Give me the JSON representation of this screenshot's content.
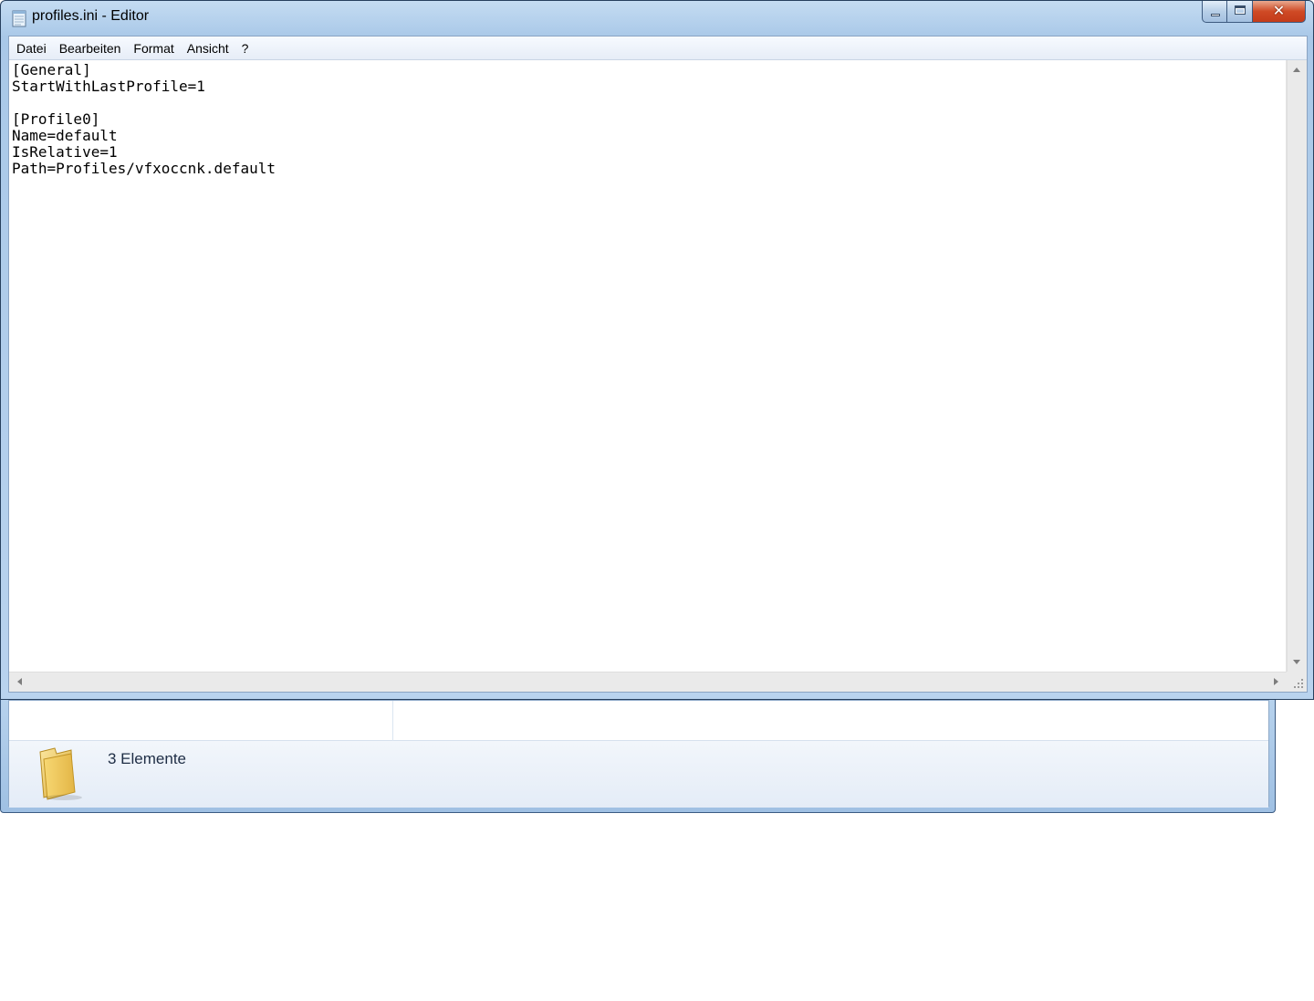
{
  "explorer": {
    "status_text": "3 Elemente",
    "icon": "folder-icon"
  },
  "window": {
    "title": "profiles.ini - Editor",
    "icon": "notepad-icon",
    "controls": {
      "minimize": "minimize-icon",
      "maximize": "maximize-icon",
      "close_glyph": "✕"
    }
  },
  "menubar": {
    "items": [
      {
        "label": "Datei"
      },
      {
        "label": "Bearbeiten"
      },
      {
        "label": "Format"
      },
      {
        "label": "Ansicht"
      },
      {
        "label": "?"
      }
    ]
  },
  "editor": {
    "content": "[General]\nStartWithLastProfile=1\n\n[Profile0]\nName=default\nIsRelative=1\nPath=Profiles/vfxoccnk.default"
  },
  "colors": {
    "frame": "#b9d3ee",
    "close_button": "#c43b1a",
    "editor_background": "#ffffff"
  }
}
